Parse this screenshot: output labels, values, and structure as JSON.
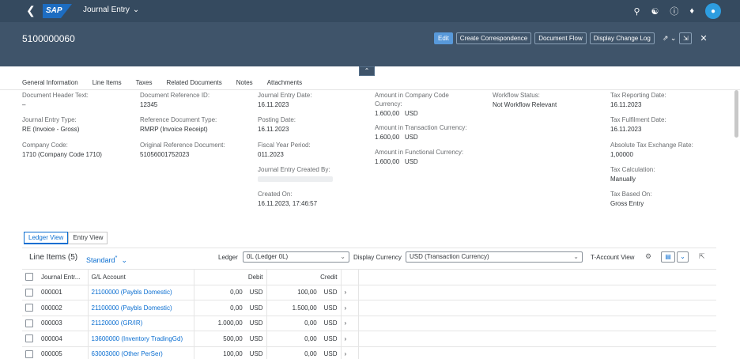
{
  "shell": {
    "logo": "SAP",
    "app_title": "Journal Entry",
    "icons": [
      "search-icon",
      "headset-icon",
      "help-icon",
      "bell-icon",
      "user-avatar"
    ]
  },
  "header": {
    "document_number": "5100000060",
    "actions": {
      "edit": "Edit",
      "create_correspondence": "Create Correspondence",
      "document_flow": "Document Flow",
      "display_change_log": "Display Change Log"
    }
  },
  "anchor_tabs": [
    "General Information",
    "Line Items",
    "Taxes",
    "Related Documents",
    "Notes",
    "Attachments"
  ],
  "fields": {
    "doc_header_text": {
      "label": "Document Header Text:",
      "value": "–"
    },
    "je_type": {
      "label": "Journal Entry Type:",
      "value": "RE (Invoice - Gross)"
    },
    "company_code": {
      "label": "Company Code:",
      "value": "1710 (Company Code 1710)"
    },
    "doc_ref_id": {
      "label": "Document Reference ID:",
      "value": "12345"
    },
    "ref_doc_type": {
      "label": "Reference Document Type:",
      "value": "RMRP (Invoice Receipt)"
    },
    "orig_ref_doc": {
      "label": "Original Reference Document:",
      "value": "51056001752023"
    },
    "je_date": {
      "label": "Journal Entry Date:",
      "value": "16.11.2023"
    },
    "posting_date": {
      "label": "Posting Date:",
      "value": "16.11.2023"
    },
    "fiscal_period": {
      "label": "Fiscal Year Period:",
      "value": "011.2023"
    },
    "created_by": {
      "label": "Journal Entry Created By:",
      "value": ""
    },
    "created_on": {
      "label": "Created On:",
      "value": "16.11.2023, 17:46:57"
    },
    "amt_cc_line1": "Amount in Company Code",
    "amt_cc_line2": "Currency:",
    "amt_cc_value": "1.600,00",
    "amt_cc_cur": "USD",
    "amt_tc": {
      "label": "Amount in Transaction Currency:",
      "value": "1.600,00",
      "currency": "USD"
    },
    "amt_fc": {
      "label": "Amount in Functional Currency:",
      "value": "1.600,00",
      "currency": "USD"
    },
    "workflow": {
      "label": "Workflow Status:",
      "value": "Not Workflow Relevant"
    },
    "tax_reporting": {
      "label": "Tax Reporting Date:",
      "value": "16.11.2023"
    },
    "tax_fulfilment": {
      "label": "Tax Fulfilment Date:",
      "value": "16.11.2023"
    },
    "abs_tax_rate": {
      "label": "Absolute Tax Exchange Rate:",
      "value": "1,00000"
    },
    "tax_calc": {
      "label": "Tax Calculation:",
      "value": "Manually"
    },
    "tax_based": {
      "label": "Tax Based On:",
      "value": "Gross Entry"
    }
  },
  "views": {
    "ledger": "Ledger View",
    "entry": "Entry View"
  },
  "line_items": {
    "title": "Line Items (5)",
    "variant": "Standard",
    "variant_mark": "*",
    "ledger_label": "Ledger",
    "ledger_value": "0L (Ledger 0L)",
    "currency_label": "Display Currency",
    "currency_value": "USD (Transaction Currency)",
    "t_account": "T-Account View",
    "columns": {
      "je": "Journal Entr...",
      "gl": "G/L Account",
      "debit": "Debit",
      "credit": "Credit"
    },
    "rows": [
      {
        "je": "000001",
        "gl": "21100000 (Paybls Domestic)",
        "debit": "0,00",
        "debit_cur": "USD",
        "credit": "100,00",
        "credit_cur": "USD"
      },
      {
        "je": "000002",
        "gl": "21100000 (Paybls Domestic)",
        "debit": "0,00",
        "debit_cur": "USD",
        "credit": "1.500,00",
        "credit_cur": "USD"
      },
      {
        "je": "000003",
        "gl": "21120000 (GR/IR)",
        "debit": "1.000,00",
        "debit_cur": "USD",
        "credit": "0,00",
        "credit_cur": "USD"
      },
      {
        "je": "000004",
        "gl": "13600000 (Inventory TradingGd)",
        "debit": "500,00",
        "debit_cur": "USD",
        "credit": "0,00",
        "credit_cur": "USD"
      },
      {
        "je": "000005",
        "gl": "63003000 (Other PerSer)",
        "debit": "100,00",
        "debit_cur": "USD",
        "credit": "0,00",
        "credit_cur": "USD"
      }
    ]
  },
  "colors": {
    "shell": "#354a5f",
    "header": "#3f546a",
    "primary": "#5899da",
    "link": "#0a6ed1"
  }
}
